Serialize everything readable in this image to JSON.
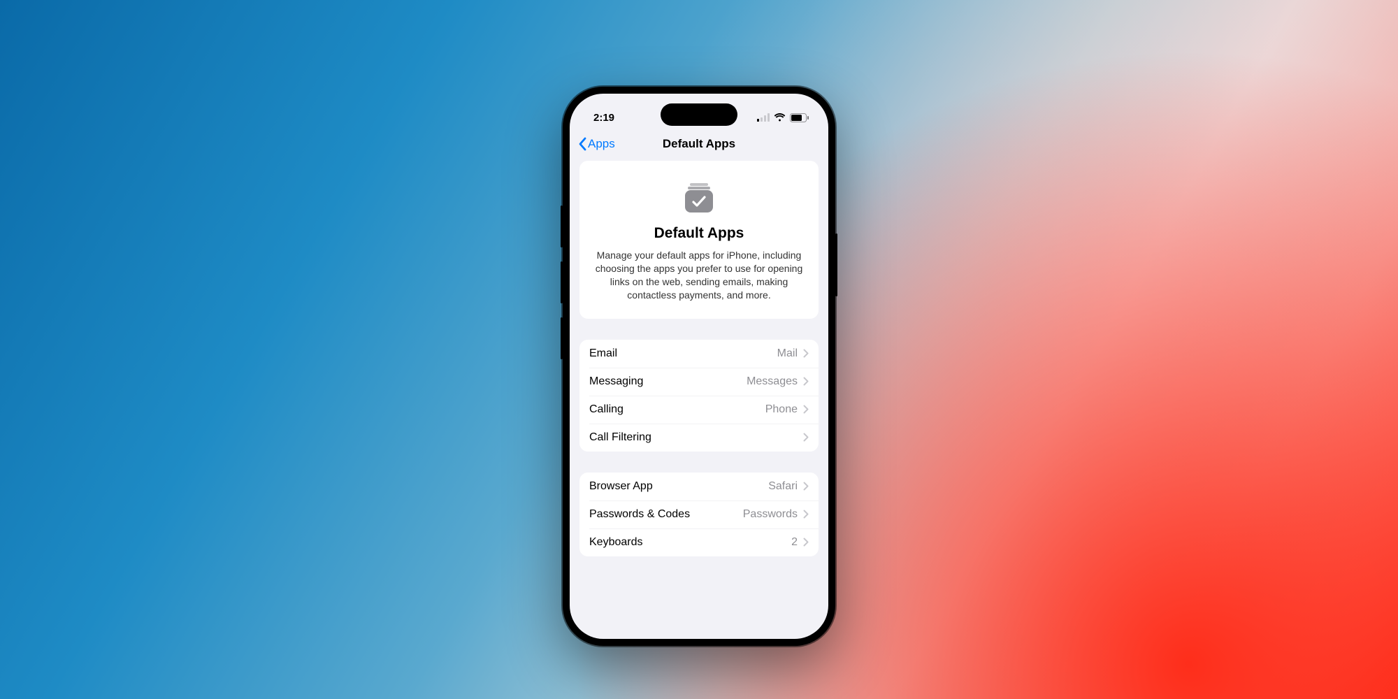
{
  "status": {
    "time": "2:19"
  },
  "nav": {
    "back": "Apps",
    "title": "Default Apps"
  },
  "hero": {
    "title": "Default Apps",
    "subtitle": "Manage your default apps for iPhone, including choosing the apps you prefer to use for opening links on the web, sending emails, making contactless payments, and more."
  },
  "groups": [
    {
      "rows": [
        {
          "label": "Email",
          "value": "Mail"
        },
        {
          "label": "Messaging",
          "value": "Messages"
        },
        {
          "label": "Calling",
          "value": "Phone"
        },
        {
          "label": "Call Filtering",
          "value": ""
        }
      ]
    },
    {
      "rows": [
        {
          "label": "Browser App",
          "value": "Safari"
        },
        {
          "label": "Passwords & Codes",
          "value": "Passwords"
        },
        {
          "label": "Keyboards",
          "value": "2"
        }
      ]
    }
  ]
}
